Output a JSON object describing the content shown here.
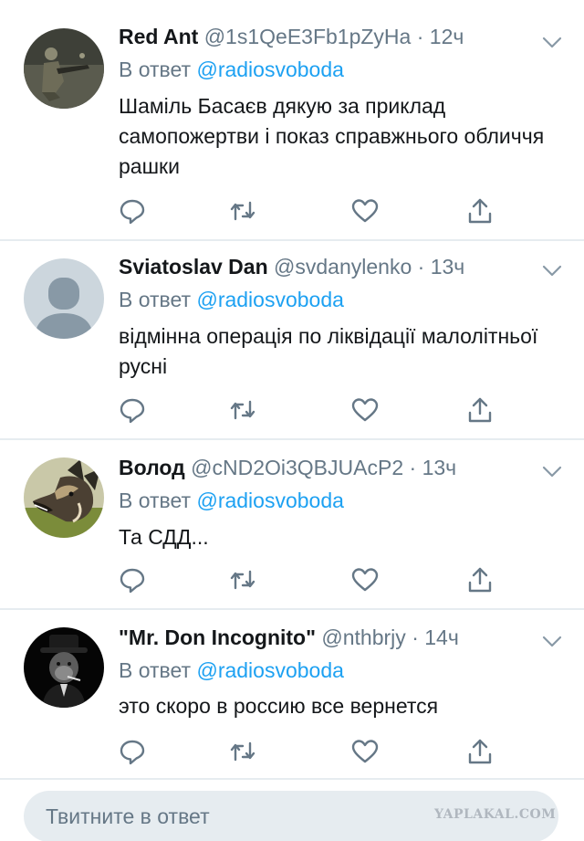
{
  "reply_prefix": "В ответ",
  "reply_mention": "@radiosvoboda",
  "dot": "·",
  "tweets": [
    {
      "name": "Red Ant",
      "handle": "@1s1QeE3Fb1pZyHa",
      "time": "12ч",
      "text": "Шаміль Басаєв дякую за приклад самопожертви і показ справжнього обличчя рашки",
      "avatar": "soldier-avatar"
    },
    {
      "name": "Sviatoslav Dan",
      "handle": "@svdanylenko",
      "time": "13ч",
      "text": "відмінна операція по ліквідації малолітньої русні",
      "avatar": "default-profile-avatar"
    },
    {
      "name": "Волод",
      "handle": "@cND2Oi3QBJUAcP2",
      "time": "13ч",
      "text": "Та СДД...",
      "avatar": "wild-dog-avatar"
    },
    {
      "name": "\"Mr. Don Incognito\"",
      "handle": "@nthbrjy",
      "time": "14ч",
      "text": "это скоро в россию все вернется",
      "avatar": "chimp-in-hat-avatar"
    }
  ],
  "composer": {
    "placeholder": "Твитните в ответ"
  },
  "watermark": "YAPLAKAL.COM",
  "colors": {
    "accent": "#1da1f2",
    "secondary_text": "#657786",
    "divider": "#e6ecf0",
    "icon": "#657786"
  }
}
